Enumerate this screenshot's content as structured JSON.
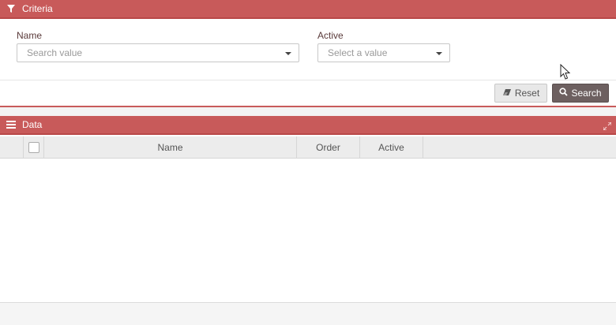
{
  "criteria_panel": {
    "title": "Criteria",
    "icon": "filter-icon",
    "fields": {
      "name": {
        "label": "Name",
        "placeholder": "Search value"
      },
      "active": {
        "label": "Active",
        "placeholder": "Select a value"
      }
    },
    "buttons": {
      "reset_label": "Reset",
      "reset_icon": "eraser-icon",
      "search_label": "Search",
      "search_icon": "search-icon"
    }
  },
  "data_panel": {
    "title": "Data",
    "icon": "list-icon",
    "expand_icon": "expand-icon",
    "columns": [
      "Name",
      "Order",
      "Active"
    ],
    "rows": []
  },
  "colors": {
    "header_bg": "#c85a5a",
    "search_button_bg": "#6d6060",
    "reset_button_bg": "#e8e8e8"
  }
}
